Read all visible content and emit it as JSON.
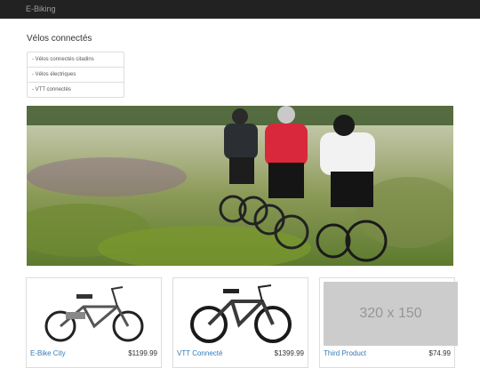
{
  "navbar": {
    "brand": "E-Biking"
  },
  "sidebar": {
    "title": "Vélos connectés",
    "items": [
      {
        "label": "- Vélos connectés citadins"
      },
      {
        "label": "- Vélos électriques"
      },
      {
        "label": "- VTT connectés"
      }
    ]
  },
  "products": [
    {
      "name": "E-Bike City",
      "price": "$1199.99"
    },
    {
      "name": "VTT Connecté",
      "price": "$1399.99"
    },
    {
      "name": "Third Product",
      "price": "$74.99",
      "placeholder": "320 x 150"
    }
  ]
}
